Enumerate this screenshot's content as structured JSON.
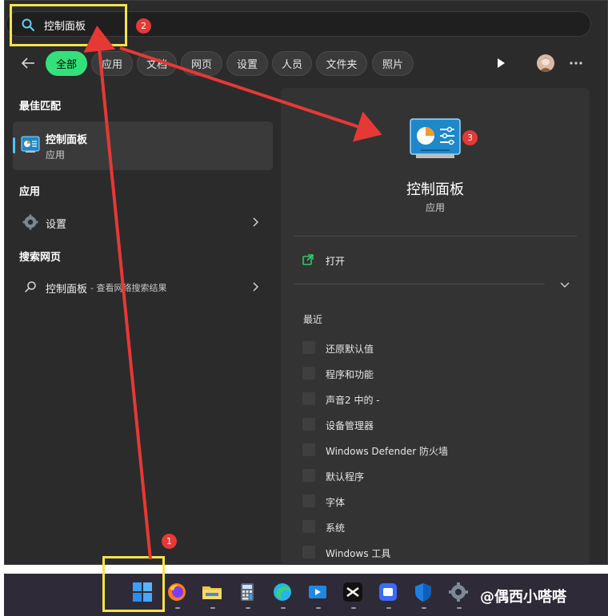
{
  "search": {
    "query": "控制面板"
  },
  "filters": {
    "chips": [
      {
        "label": "全部",
        "active": true
      },
      {
        "label": "应用",
        "active": false
      },
      {
        "label": "文档",
        "active": false
      },
      {
        "label": "网页",
        "active": false
      },
      {
        "label": "设置",
        "active": false
      },
      {
        "label": "人员",
        "active": false
      },
      {
        "label": "文件夹",
        "active": false
      },
      {
        "label": "照片",
        "active": false
      }
    ]
  },
  "left": {
    "best_match_title": "最佳匹配",
    "best_match": {
      "name": "控制面板",
      "type": "应用",
      "icon": "control-panel-icon"
    },
    "apps_title": "应用",
    "apps": [
      {
        "label": "设置",
        "icon": "gear-icon"
      }
    ],
    "web_title": "搜索网页",
    "web": {
      "query": "控制面板",
      "suffix": " - 查看网络搜索结果"
    }
  },
  "detail": {
    "name": "控制面板",
    "type": "应用",
    "open_label": "打开",
    "recent_title": "最近",
    "recent": [
      "还原默认值",
      "程序和功能",
      "声音2 中的 -",
      "设备管理器",
      "Windows Defender 防火墙",
      "默认程序",
      "字体",
      "系统",
      "Windows 工具"
    ]
  },
  "taskbar": {
    "apps": [
      "start-icon",
      "firefox-icon",
      "file-explorer-icon",
      "calculator-icon",
      "edge-icon",
      "video-editor-icon",
      "capcut-icon",
      "app-icon",
      "security-shield-icon",
      "settings-gear-icon"
    ],
    "watermark": "@偶西小嗒嗒"
  },
  "annotations": {
    "badges": [
      "1",
      "2",
      "3"
    ]
  },
  "colors": {
    "accent": "#34e07a",
    "highlight": "#f6e34a",
    "arrow": "#e53935"
  }
}
